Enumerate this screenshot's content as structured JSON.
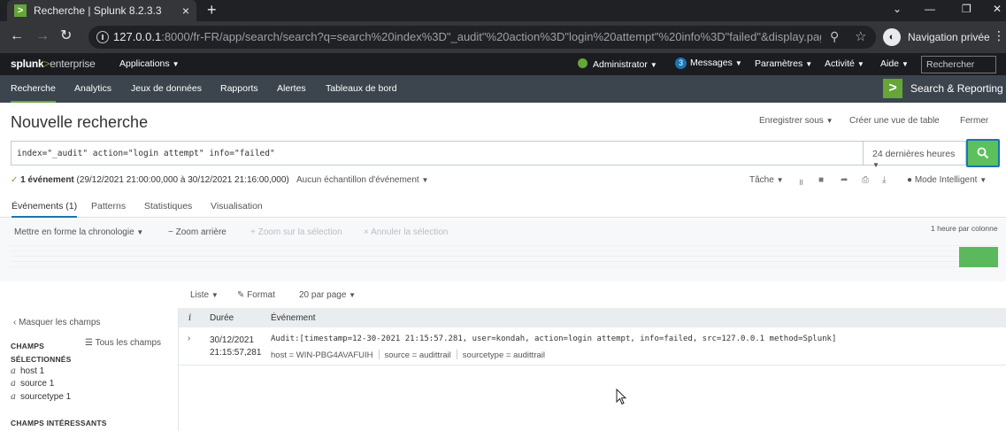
{
  "browser": {
    "tab_title": "Recherche | Splunk 8.2.3.3",
    "favicon": ">",
    "new_tab": "+",
    "url_host": "127.0.0.1",
    "url_rest": ":8000/fr-FR/app/search/search?q=search%20index%3D\"_audit\"%20action%3D\"login%20attempt\"%20info%3D\"failed\"&display.page....",
    "incognito_label": "Navigation privée"
  },
  "splunk_bar": {
    "logo_splunk": "splunk",
    "logo_gt": ">",
    "logo_enterprise": "enterprise",
    "applications": "Applications",
    "admin": "Administrator",
    "messages_count": "3",
    "messages": "Messages",
    "settings": "Paramètres",
    "activity": "Activité",
    "help": "Aide",
    "search_placeholder": "Rechercher"
  },
  "app_nav": {
    "items": [
      "Recherche",
      "Analytics",
      "Jeux de données",
      "Rapports",
      "Alertes",
      "Tableaux de bord"
    ],
    "app_logo": ">",
    "app_name": "Search & Reporting"
  },
  "header": {
    "title": "Nouvelle recherche",
    "save_as": "Enregistrer sous",
    "create_table": "Créer une vue de table",
    "close": "Fermer"
  },
  "search": {
    "query": "index=\"_audit\" action=\"login attempt\" info=\"failed\"",
    "time_range": "24 dernières heures"
  },
  "status": {
    "check": "✓",
    "count": "1 événement",
    "range": "(29/12/2021 21:00:00,000 à 30/12/2021 21:16:00,000)",
    "sampling": "Aucun échantillon d'événement",
    "job": "Tâche",
    "mode": "Mode Intelligent"
  },
  "result_tabs": [
    "Événements (1)",
    "Patterns",
    "Statistiques",
    "Visualisation"
  ],
  "timeline": {
    "format": "Mettre en forme la chronologie",
    "zoom_out": "− Zoom arrière",
    "zoom_selection": "+ Zoom sur la sélection",
    "cancel_selection": "× Annuler la sélection",
    "scale": "1 heure par colonne"
  },
  "results_toolbar": {
    "list": "Liste",
    "format": "Format",
    "per_page": "20 par page"
  },
  "fields": {
    "hide": "Masquer les champs",
    "all_fields": "Tous les champs",
    "selected_heading_1": "CHAMPS",
    "selected_heading_2": "SÉLECTIONNÉS",
    "selected": [
      {
        "name": "host",
        "count": "1"
      },
      {
        "name": "source",
        "count": "1"
      },
      {
        "name": "sourcetype",
        "count": "1"
      }
    ],
    "interesting_heading": "CHAMPS INTÉRESSANTS"
  },
  "events_table": {
    "col_info": "i",
    "col_time": "Durée",
    "col_event": "Événement",
    "rows": [
      {
        "date": "30/12/2021",
        "time": "21:15:57,281",
        "raw": "Audit:[timestamp=12-30-2021 21:15:57.281, user=kondah, action=login attempt, info=failed, src=127.0.0.1 method=Splunk]",
        "host": "host = WIN-PBG4AVAFUIH",
        "source": "source = audittrail",
        "sourcetype": "sourcetype = audittrail"
      }
    ]
  },
  "colors": {
    "splunk_green": "#65a637",
    "nav_bg": "#3c444d",
    "search_button": "#5cc05c",
    "link_blue": "#1a74b5"
  }
}
